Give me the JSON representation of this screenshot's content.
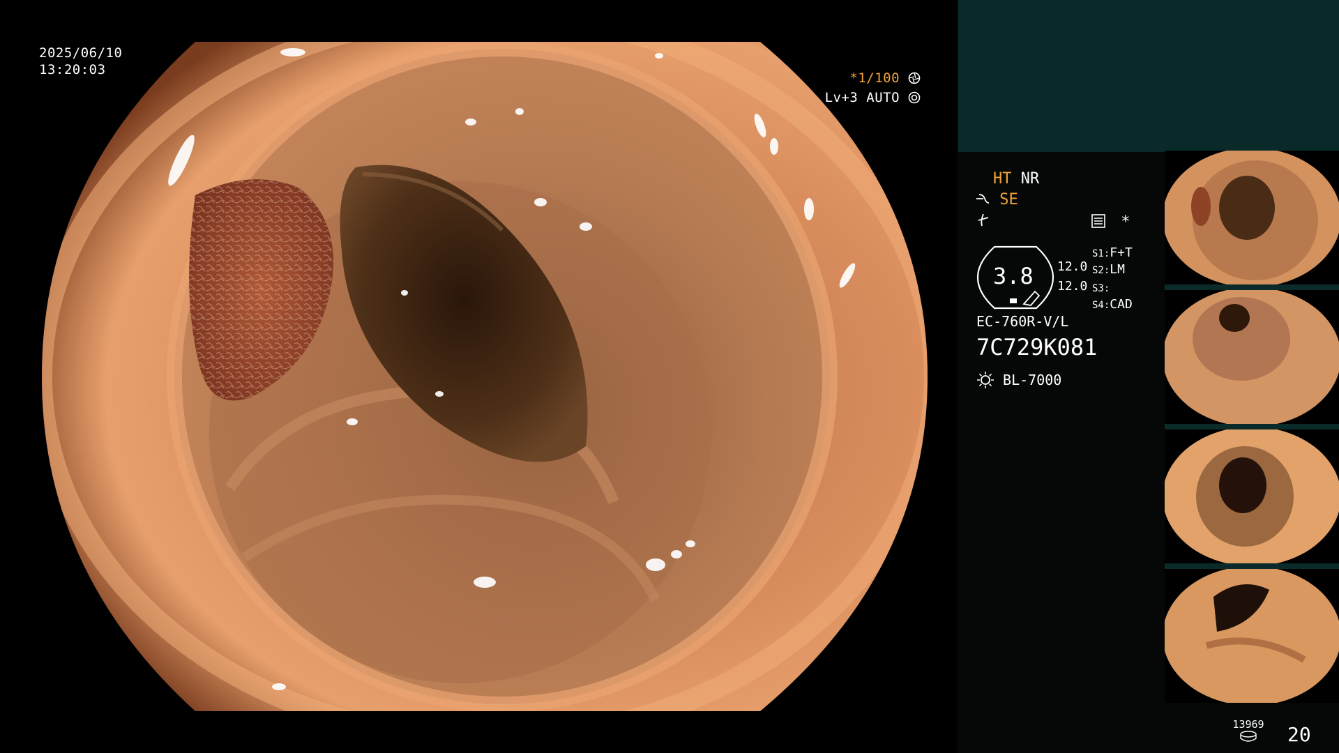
{
  "monitor": {
    "date": "2025/06/10",
    "time": "13:20:03",
    "shutter_value": "*1/100",
    "shutter_icon": "shutter-icon",
    "iris_value": "Lv+3 AUTO",
    "iris_icon": "iris-icon"
  },
  "panel": {
    "mode_ht": "HT",
    "mode_nr": "NR",
    "mode_se": "SE",
    "se_icon": "scope-bend-icon",
    "edge_icon": "edge-enhance-icon",
    "settings_icon": "settings-panel-icon",
    "asterisk": "*",
    "gauge_value": "3.8",
    "gauge_left_top": "12.0",
    "gauge_left_bottom": "12.0",
    "switches": [
      {
        "key": "S1:",
        "value": "F+T"
      },
      {
        "key": "S2:",
        "value": "LM"
      },
      {
        "key": "S3:",
        "value": ""
      },
      {
        "key": "S4:",
        "value": "CAD"
      }
    ],
    "scope_model": "EC-760R-V/L",
    "serial": "7C729K081",
    "light_icon": "light-source-icon",
    "light_source": "BL-7000",
    "storage_count": "13969",
    "storage_icon": "storage-disk-icon",
    "image_count": "20"
  },
  "colors": {
    "accent": "#f2a33a",
    "panel_bg": "#050807",
    "panel_top": "#0a2a29",
    "tissue": "#d98a5a",
    "lumen": "#3b2412"
  }
}
